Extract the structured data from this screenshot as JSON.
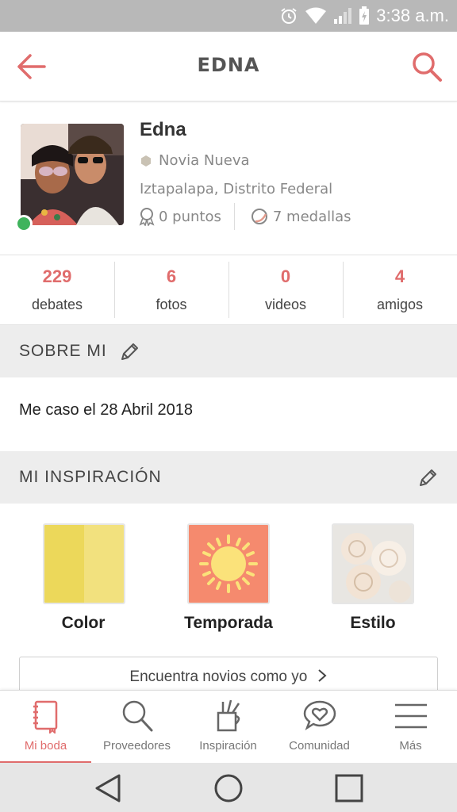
{
  "status_bar": {
    "time": "3:38 a.m."
  },
  "header": {
    "title": "EDNA"
  },
  "profile": {
    "name": "Edna",
    "role": "Novia Nueva",
    "location": "Iztapalapa, Distrito Federal",
    "points": "0 puntos",
    "medals": "7 medallas"
  },
  "counts": [
    {
      "value": "229",
      "label": "debates"
    },
    {
      "value": "6",
      "label": "fotos"
    },
    {
      "value": "0",
      "label": "videos"
    },
    {
      "value": "4",
      "label": "amigos"
    }
  ],
  "about": {
    "title": "SOBRE MI",
    "text": "Me caso el 28 Abril 2018"
  },
  "inspiration": {
    "title": "MI INSPIRACIÓN",
    "items": [
      {
        "label": "Color"
      },
      {
        "label": "Temporada"
      },
      {
        "label": "Estilo"
      }
    ],
    "find_button": "Encuentra novios como yo"
  },
  "bottom_nav": [
    {
      "label": "Mi boda",
      "icon": "notebook-icon",
      "active": true
    },
    {
      "label": "Proveedores",
      "icon": "search-icon"
    },
    {
      "label": "Inspiración",
      "icon": "pencil-cup-icon"
    },
    {
      "label": "Comunidad",
      "icon": "heart-chat-icon"
    },
    {
      "label": "Más",
      "icon": "menu-icon"
    }
  ],
  "colors": {
    "accent": "#e06c6c",
    "online": "#3fb35c",
    "color_swatch_1": "#ecd85a",
    "color_swatch_2": "#f2e17e",
    "season_bg": "#f58a6e",
    "sun": "#fbe27a"
  }
}
